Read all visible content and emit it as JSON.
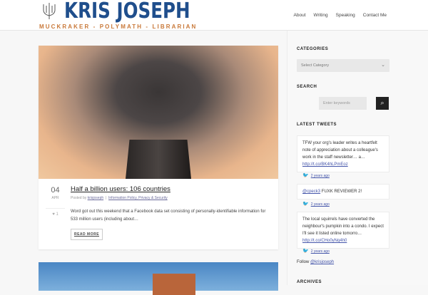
{
  "header": {
    "logo_title": "KRIS JOSEPH",
    "logo_tagline": "MUCKRAKER - POLYMATH - LIBRARIAN",
    "nav": [
      "About",
      "Writing",
      "Speaking",
      "Contact Me"
    ]
  },
  "post": {
    "day": "04",
    "month": "APR",
    "likes": "1",
    "title": "Half a billion users: 106 countries",
    "posted_by_label": "Posted by",
    "author": "krisjoseph",
    "categories": "Information Policy, Privacy & Security",
    "excerpt": "Word got out this weekend that a Facebook data set consisting of personally-identifiable information for 533 million users (including about…",
    "read_more": "READ MORE"
  },
  "sidebar": {
    "categories_title": "CATEGORIES",
    "categories_select": "Select Category",
    "search_title": "SEARCH",
    "search_placeholder": "Enter keywords",
    "tweets_title": "LATEST TWEETS",
    "tweets": [
      {
        "text": "TFW your org's leader writes a heartfelt note of appreciation about a colleague's work in the staff newsletter… a…",
        "link": "http://t.co/BK4hLPmEoz",
        "time": "2 years ago"
      },
      {
        "mention": "@cpeck3",
        "text": "FUXK REVIEWER 2!",
        "time": "2 years ago"
      },
      {
        "text": "The local squirrels have converted the neighbour's pumpkin into a condo. I expect I'll see it listed online tomorro…",
        "link": "http://t.co/CHo0yNq4h0",
        "time": "2 years ago"
      }
    ],
    "follow_label": "Follow",
    "follow_handle": "@krisjoseph",
    "archives_title": "ARCHIVES"
  }
}
